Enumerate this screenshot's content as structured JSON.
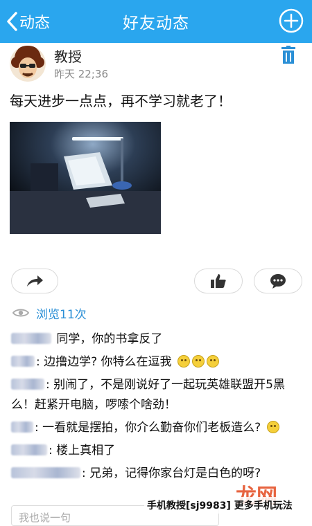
{
  "header": {
    "back_label": "动态",
    "title": "好友动态",
    "accent": "#2aa6ee"
  },
  "post": {
    "author": "教授",
    "time": "昨天  22;36",
    "text": "每天进步一点点，再不学习就老了！"
  },
  "stats": {
    "views_label": "浏览11次"
  },
  "comments": [
    {
      "text": "同学，你的书拿反了"
    },
    {
      "text": ": 边撸边学? 你特么在逗我"
    },
    {
      "text": ": 别闹了，不是刚说好了一起玩英雄联盟开5黑么！赶紧开电脑，啰嗦个啥劲！"
    },
    {
      "text": ": 一看就是摆拍，你介么勤奋你们老板造么?"
    },
    {
      "text": ": 楼上真相了"
    },
    {
      "text": ": 兄弟，记得你家台灯是白色的呀?"
    }
  ],
  "reply": {
    "placeholder": "我也说一句"
  },
  "watermark": {
    "text": "手机教授[sj9983] 更多手机玩法",
    "logo": "龙网"
  },
  "icons": {
    "back": "chevron-left-icon",
    "add": "plus-circle-icon",
    "delete": "trash-icon",
    "share": "share-arrow-icon",
    "like": "thumbs-up-icon",
    "comment": "speech-bubble-icon",
    "views": "eye-icon"
  }
}
